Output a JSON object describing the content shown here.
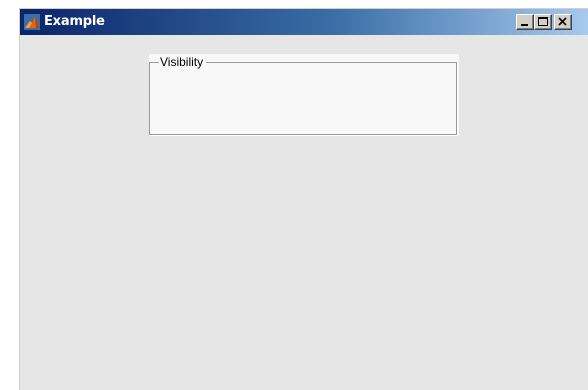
{
  "window": {
    "title": "Example",
    "icon": "matlab-icon",
    "controls": {
      "minimize_icon": "minimize-icon",
      "maximize_icon": "maximize-icon",
      "close_icon": "close-icon"
    },
    "colors": {
      "titlebar_start": "#0a246a",
      "titlebar_end": "#a6caf0",
      "background": "#e6e6e6"
    }
  },
  "panel": {
    "title": "Visibility"
  }
}
